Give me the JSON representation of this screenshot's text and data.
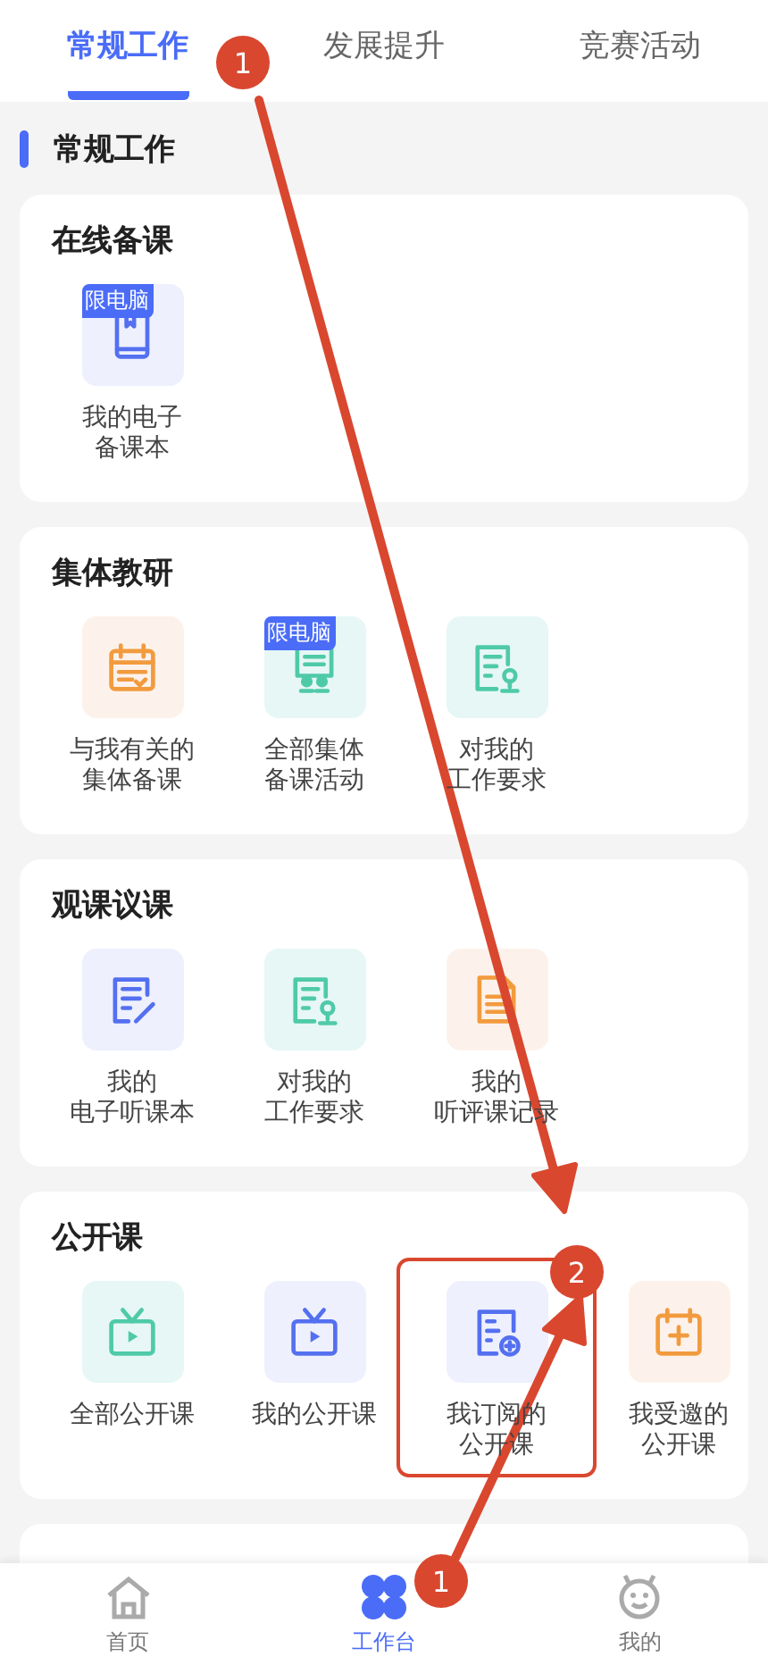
{
  "tabs": [
    {
      "label": "常规工作",
      "selected": true
    },
    {
      "label": "发展提升",
      "selected": false
    },
    {
      "label": "竞赛活动",
      "selected": false
    }
  ],
  "section_title": "常规工作",
  "cards": [
    {
      "title": "在线备课",
      "items": [
        {
          "lines": [
            "我的电子",
            "备课本"
          ],
          "kind": "book",
          "color": "#5470f0",
          "badge": "限电脑",
          "highlighted": false
        }
      ]
    },
    {
      "title": "集体教研",
      "items": [
        {
          "lines": [
            "与我有关的",
            "集体备课"
          ],
          "kind": "calendar-check",
          "color": "#f29b3e",
          "highlighted": false
        },
        {
          "lines": [
            "全部集体",
            "备课活动"
          ],
          "kind": "board",
          "color": "#4fcaa8",
          "badge": "限电脑",
          "highlighted": false
        },
        {
          "lines": [
            "对我的",
            "工作要求"
          ],
          "kind": "doc-person",
          "color": "#4fcaa8",
          "highlighted": false
        }
      ]
    },
    {
      "title": "观课议课",
      "items": [
        {
          "lines": [
            "我的",
            "电子听课本"
          ],
          "kind": "doc-pen",
          "color": "#5470f0",
          "highlighted": false
        },
        {
          "lines": [
            "对我的",
            "工作要求"
          ],
          "kind": "doc-person",
          "color": "#4fcaa8",
          "highlighted": false
        },
        {
          "lines": [
            "我的",
            "听评课记录"
          ],
          "kind": "doc",
          "color": "#f29b3e",
          "highlighted": false
        }
      ]
    },
    {
      "title": "公开课",
      "items": [
        {
          "lines": [
            "全部公开课"
          ],
          "kind": "tv",
          "color": "#4fcaa8",
          "highlighted": false
        },
        {
          "lines": [
            "我的公开课"
          ],
          "kind": "tv",
          "color": "#5470f0",
          "highlighted": false
        },
        {
          "lines": [
            "我订阅的",
            "公开课"
          ],
          "kind": "doc-plus",
          "color": "#5470f0",
          "highlighted": true
        },
        {
          "lines": [
            "我受邀的",
            "公开课"
          ],
          "kind": "calendar-plus",
          "color": "#f29b3e",
          "highlighted": false
        }
      ]
    }
  ],
  "nav": [
    {
      "label": "首页",
      "kind": "home",
      "selected": false
    },
    {
      "label": "工作台",
      "kind": "grid",
      "selected": true
    },
    {
      "label": "我的",
      "kind": "face",
      "selected": false
    }
  ],
  "annotations": [
    {
      "number": "1",
      "kind": "tab-pointer"
    },
    {
      "number": "2",
      "kind": "highlight"
    },
    {
      "number": "1",
      "kind": "nav-pointer"
    }
  ]
}
